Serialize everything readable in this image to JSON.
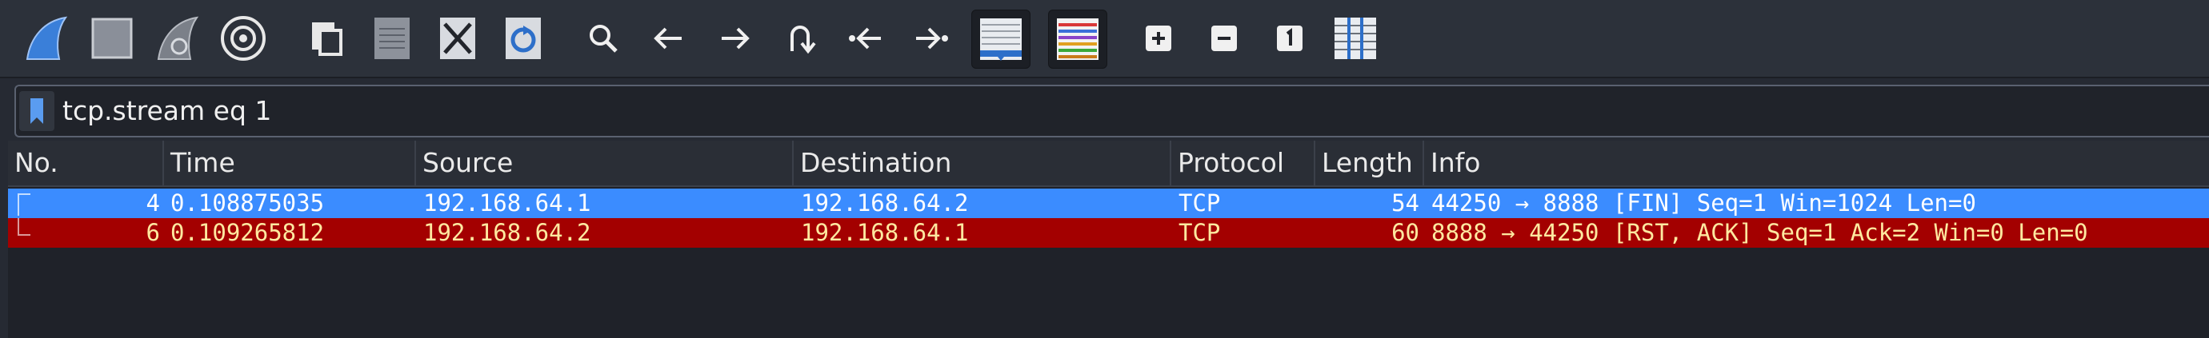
{
  "toolbar": {
    "buttons": [
      {
        "name": "start-capture-icon"
      },
      {
        "name": "stop-capture-icon"
      },
      {
        "name": "restart-capture-icon"
      },
      {
        "name": "capture-options-icon"
      },
      {
        "name": "open-file-icon"
      },
      {
        "name": "save-file-icon"
      },
      {
        "name": "close-file-icon"
      },
      {
        "name": "reload-file-icon"
      },
      {
        "name": "find-packet-icon"
      },
      {
        "name": "go-back-icon"
      },
      {
        "name": "go-forward-icon"
      },
      {
        "name": "go-to-packet-icon"
      },
      {
        "name": "first-packet-icon"
      },
      {
        "name": "last-packet-icon"
      },
      {
        "name": "autoscroll-icon"
      },
      {
        "name": "colorize-icon"
      },
      {
        "name": "zoom-in-icon"
      },
      {
        "name": "zoom-out-icon"
      },
      {
        "name": "normal-size-icon"
      },
      {
        "name": "resize-columns-icon"
      }
    ]
  },
  "filter": {
    "value": "tcp.stream eq 1"
  },
  "packet_list": {
    "columns": [
      "No.",
      "Time",
      "Source",
      "Destination",
      "Protocol",
      "Length",
      "Info"
    ],
    "rows": [
      {
        "no": "4",
        "time": "0.108875035",
        "source": "192.168.64.1",
        "destination": "192.168.64.2",
        "protocol": "TCP",
        "length": "54",
        "info": "44250 → 8888 [FIN] Seq=1 Win=1024 Len=0",
        "bg": "#3b8cff",
        "fg": "#ffffff",
        "selected": true
      },
      {
        "no": "6",
        "time": "0.109265812",
        "source": "192.168.64.2",
        "destination": "192.168.64.1",
        "protocol": "TCP",
        "length": "60",
        "info": "8888 → 44250 [RST, ACK] Seq=1 Ack=2 Win=0 Len=0",
        "bg": "#a30000",
        "fg": "#ffe9a0",
        "selected": false
      }
    ]
  },
  "colors": {
    "background": "#262a33",
    "selected_row": "#3b8cff",
    "rst_row": "#a30000",
    "rst_text": "#ffe9a0"
  }
}
